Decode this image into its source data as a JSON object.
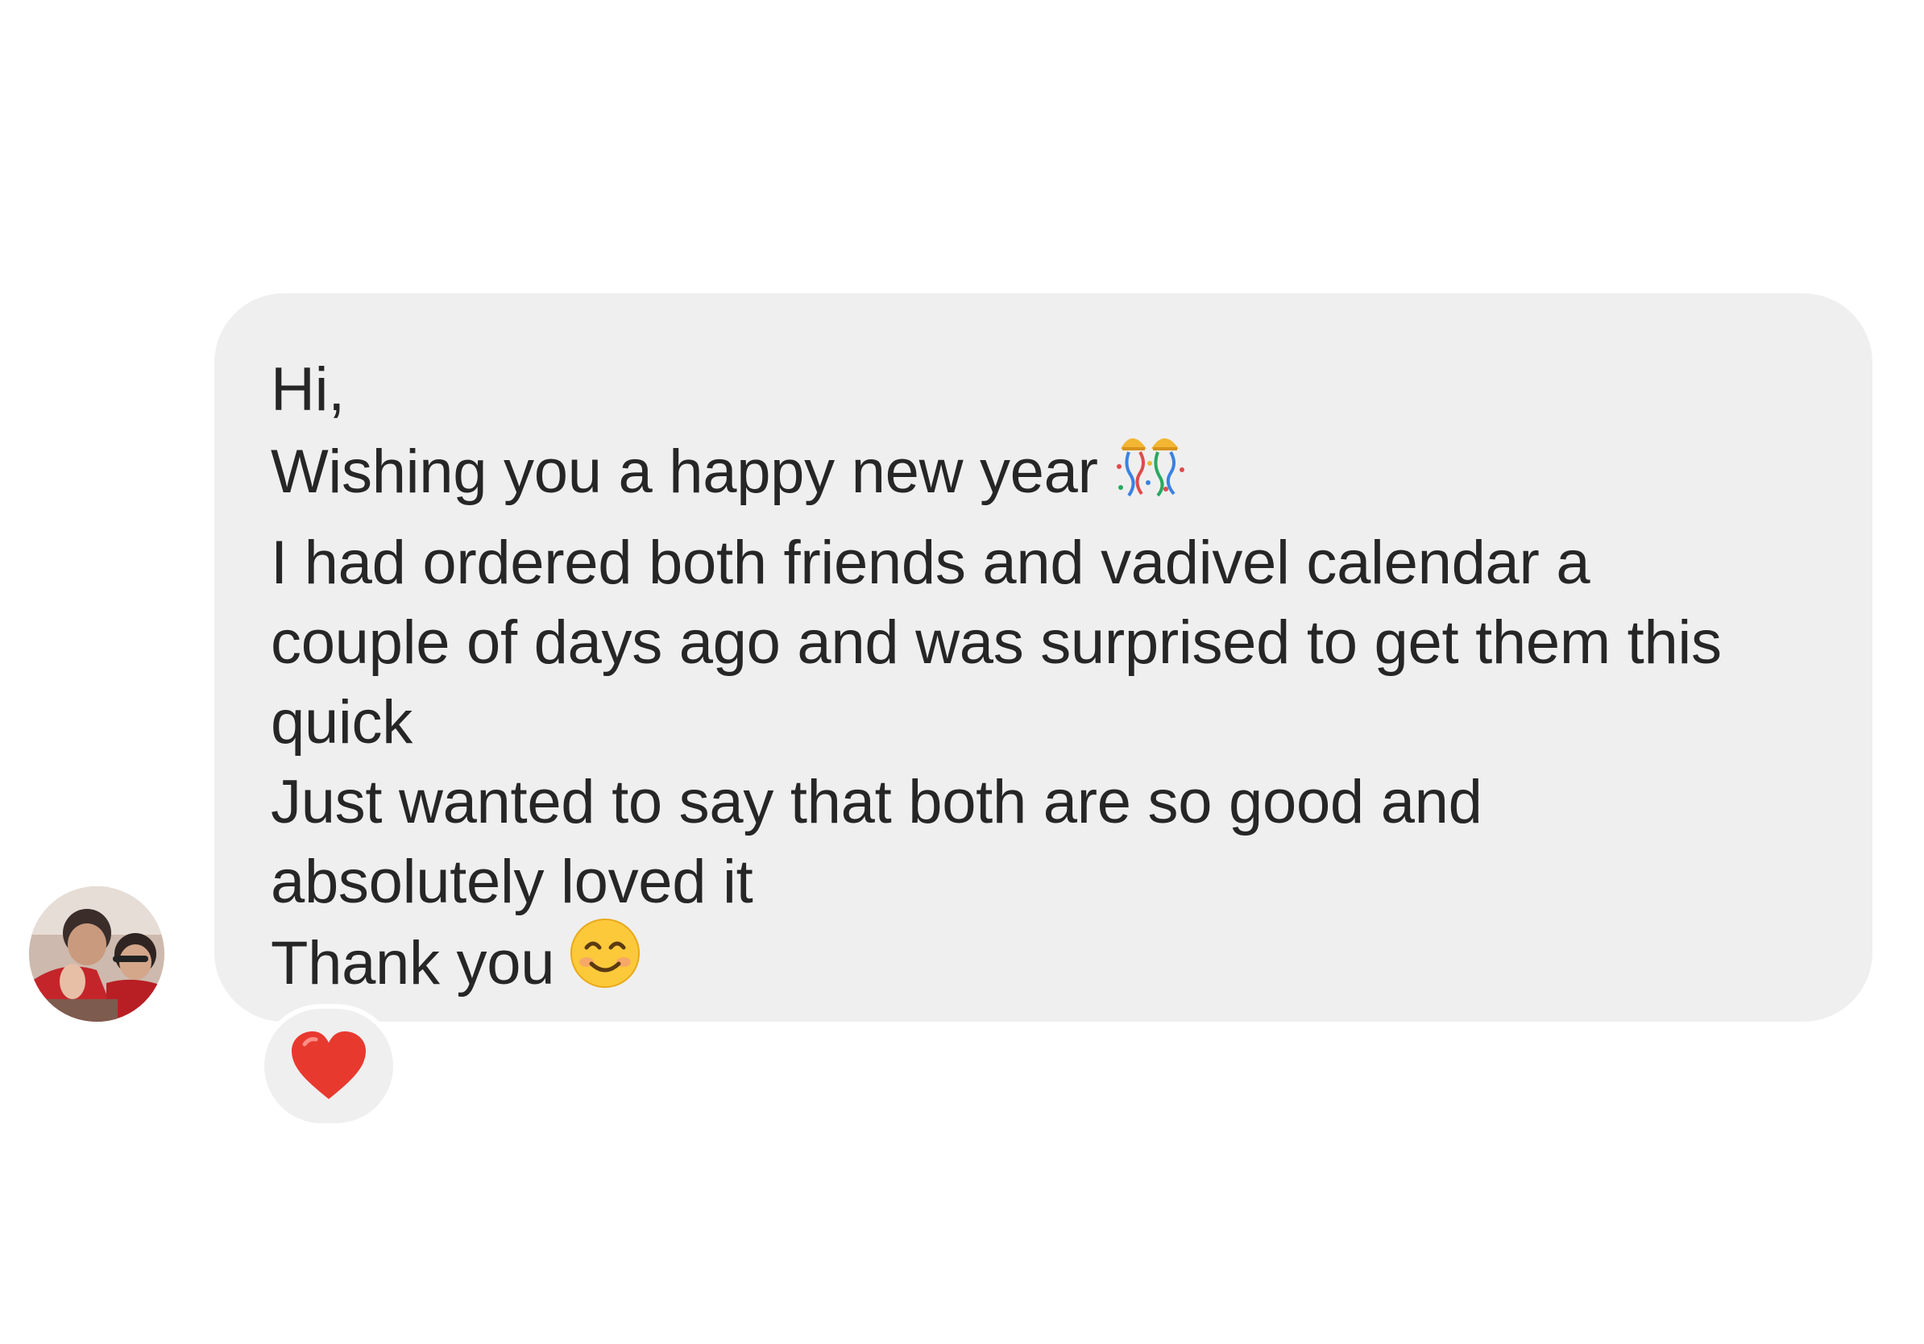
{
  "message": {
    "lines": [
      "Hi,",
      "Wishing you a happy new year",
      "I had ordered both friends and vadivel calendar a",
      "couple of days ago and was surprised to get them this",
      "quick",
      "Just wanted to say that both are so good and",
      "absolutely loved it",
      "Thank you"
    ],
    "icons": {
      "line_2": "confetti-ball-icon",
      "line_8": "smiling-face-icon"
    }
  },
  "reaction": {
    "icon": "red-heart-icon",
    "color": "#e8392f"
  },
  "avatar": {
    "icon": "sender-avatar"
  },
  "colors": {
    "bubble": "#efefef",
    "text": "#262626",
    "background": "#ffffff"
  }
}
